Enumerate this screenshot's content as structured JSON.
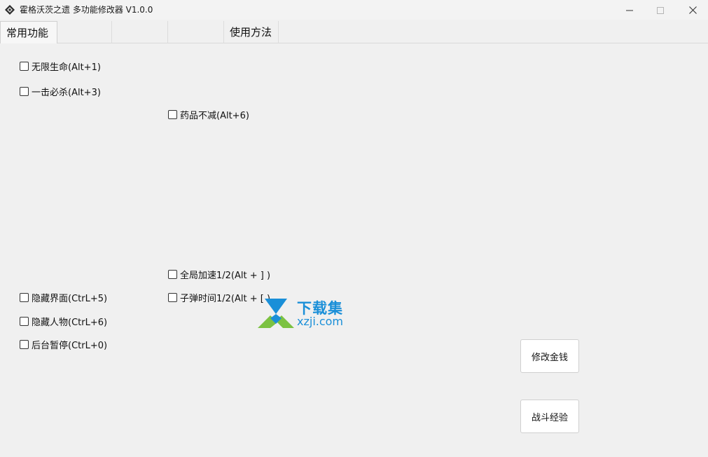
{
  "window": {
    "title": "霍格沃茨之遗 多功能修改器  V1.0.0"
  },
  "tabs": [
    {
      "label": "常用功能",
      "active": true
    },
    {
      "label": ""
    },
    {
      "label": ""
    },
    {
      "label": ""
    },
    {
      "label": "使用方法"
    }
  ],
  "options": [
    {
      "label": "无限生命(Alt+1)",
      "checked": false
    },
    {
      "label": "一击必杀(Alt+3)",
      "checked": false
    },
    {
      "label": "药品不减(Alt+6)",
      "checked": false
    },
    {
      "label": "全局加速1/2(Alt + ] )",
      "checked": false
    },
    {
      "label": "隐藏界面(CtrL+5)",
      "checked": false
    },
    {
      "label": "子弹时间1/2(Alt + [ )",
      "checked": false
    },
    {
      "label": "隐藏人物(CtrL+6)",
      "checked": false
    },
    {
      "label": "后台暂停(CtrL+0)",
      "checked": false
    }
  ],
  "buttons": {
    "money": "修改金钱",
    "exp": "战斗经验"
  },
  "watermark": {
    "brand": "下载集",
    "domain": "xzji.com"
  },
  "colors": {
    "window_bg": "#f0f0f0",
    "watermark_blue": "#1a8fd8",
    "watermark_green": "#7cc242"
  },
  "icons": {
    "app": "app-icon",
    "minimize": "minimize-icon",
    "maximize": "maximize-icon",
    "close": "close-icon"
  }
}
